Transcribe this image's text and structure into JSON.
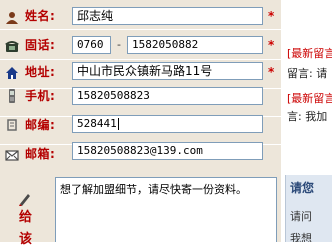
{
  "form": {
    "name": {
      "label": "姓名:",
      "value": "邱志纯",
      "required_mark": "*"
    },
    "phone": {
      "label": "固话:",
      "area_code": "0760",
      "separator": "-",
      "number": "1582050882",
      "required_mark": "*"
    },
    "address": {
      "label": "地址:",
      "value": "中山市民众镇新马路11号",
      "required_mark": "*"
    },
    "mobile": {
      "label": "手机:",
      "value": "15820508823"
    },
    "postcode": {
      "label": "邮编:",
      "value": "528441"
    },
    "email": {
      "label": "邮箱:",
      "value": "15820508823@139.com"
    },
    "message": {
      "label_line1": "给",
      "label_line2": "该",
      "value": "想了解加盟细节，请尽快寄一份资料。"
    }
  },
  "right_panel": {
    "latest_title_1": "[最新留言",
    "latest_text_1": "留言: 请",
    "latest_title_2": "[最新留言",
    "latest_text_2": "言: 我加",
    "box_title": "请您",
    "box_line_1": "请问",
    "box_line_2": "我想"
  },
  "colors": {
    "label_red": "#b40000",
    "panel_bg": "#ede6da",
    "field_border": "#7f9db9",
    "accent_blue": "#2c4a79"
  }
}
